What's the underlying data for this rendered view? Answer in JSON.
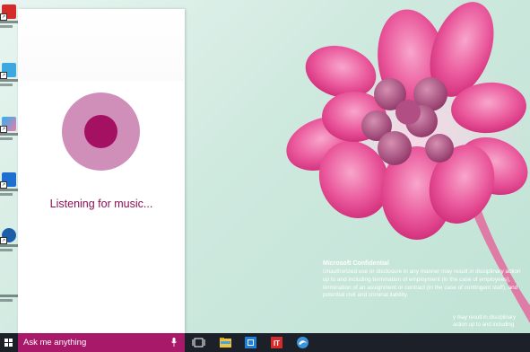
{
  "cortana": {
    "status_text": "Listening for music..."
  },
  "taskbar": {
    "search_placeholder": "Ask me anything",
    "pinned": [
      "task-view-icon",
      "file-explorer-icon",
      "store-icon",
      "it-app-icon",
      "edge-like-icon"
    ]
  },
  "desktop": {
    "confidential_title": "Microsoft Confidential",
    "confidential_text": "Unauthorized use or disclosure in any manner may result in disciplinary action up to and including termination of employment (in the case of employees), termination of an assignment or contract (in the case of contingent staff), and potential civil and criminal liability.",
    "confidential_tail": "y may result in disciplinary action up to and including"
  },
  "colors": {
    "accent": "#a8196a",
    "orb_outer": "#cf8fb9",
    "orb_inner": "#a41062",
    "taskbar": "#1c2029"
  }
}
